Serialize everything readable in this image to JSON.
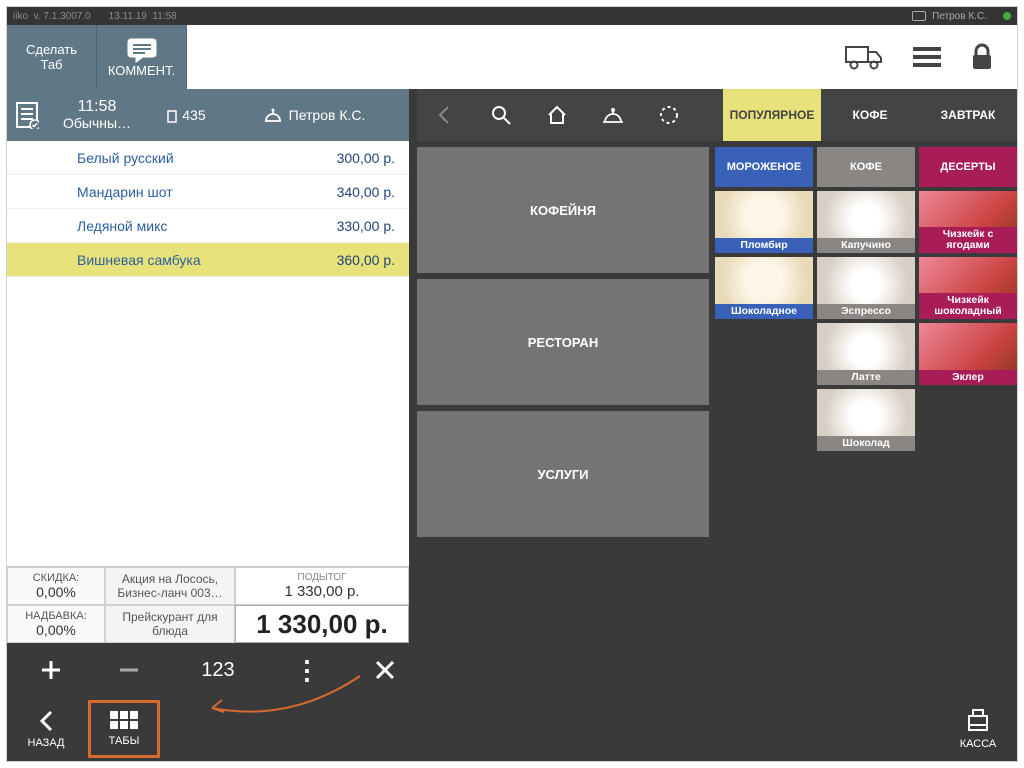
{
  "titlebar": {
    "app": "iiko",
    "ver": "v. 7.1.3007.0",
    "date": "13.11.19",
    "time": "11:58",
    "user": "Петров К.С."
  },
  "topbar": {
    "make_tab": "Сделать\nТаб",
    "comment": "КОММЕНТ."
  },
  "order_head": {
    "time": "11:58",
    "mode": "Обычны…",
    "guests": "435",
    "waiter": "Петров К.С."
  },
  "lines": [
    {
      "name": "Белый русский",
      "price": "300,00 р."
    },
    {
      "name": "Мандарин шот",
      "price": "340,00 р."
    },
    {
      "name": "Ледяной микс",
      "price": "330,00 р."
    },
    {
      "name": "Вишневая самбука",
      "price": "360,00 р."
    }
  ],
  "totals": {
    "discount_label": "СКИДКА:",
    "discount": "0,00%",
    "surcharge_label": "НАДБАВКА:",
    "surcharge": "0,00%",
    "promo": "Акция на Лосось, Бизнес-ланч 003…",
    "pricelist": "Прейскурант для блюда",
    "subtotal_label": "ПОДЫТОГ",
    "subtotal": "1 330,00 р.",
    "grand": "1 330,00 р."
  },
  "ops": {
    "qty": "123"
  },
  "cat_tabs": [
    {
      "label": "ПОПУЛЯРНОЕ",
      "kind": "pop"
    },
    {
      "label": "КОФЕ",
      "kind": ""
    },
    {
      "label": "ЗАВТРАК",
      "kind": ""
    }
  ],
  "subcats": [
    {
      "label": "МОРОЖЕНОЕ",
      "bg": "#3961b8"
    },
    {
      "label": "КОФЕ",
      "bg": "#8a8684"
    },
    {
      "label": "ДЕСЕРТЫ",
      "bg": "#a81d58"
    }
  ],
  "big_cats": [
    "КОФЕЙНЯ",
    "РЕСТОРАН",
    "УСЛУГИ"
  ],
  "products": [
    [
      {
        "label": "Пломбир",
        "c": "blue"
      },
      {
        "label": "Капучино",
        "c": "grey"
      },
      {
        "label": "Чизкейк с ягодами",
        "c": "pink"
      }
    ],
    [
      {
        "label": "Шоколадное",
        "c": "blue"
      },
      {
        "label": "Эспрессо",
        "c": "grey"
      },
      {
        "label": "Чизкейк шоколадный",
        "c": "pink"
      }
    ],
    [
      null,
      {
        "label": "Латте",
        "c": "grey"
      },
      {
        "label": "Эклер",
        "c": "pink"
      }
    ],
    [
      null,
      {
        "label": "Шоколад",
        "c": "grey"
      },
      null
    ]
  ],
  "footer": {
    "back": "НАЗАД",
    "tabs": "ТАБЫ",
    "cash": "КАССА"
  }
}
